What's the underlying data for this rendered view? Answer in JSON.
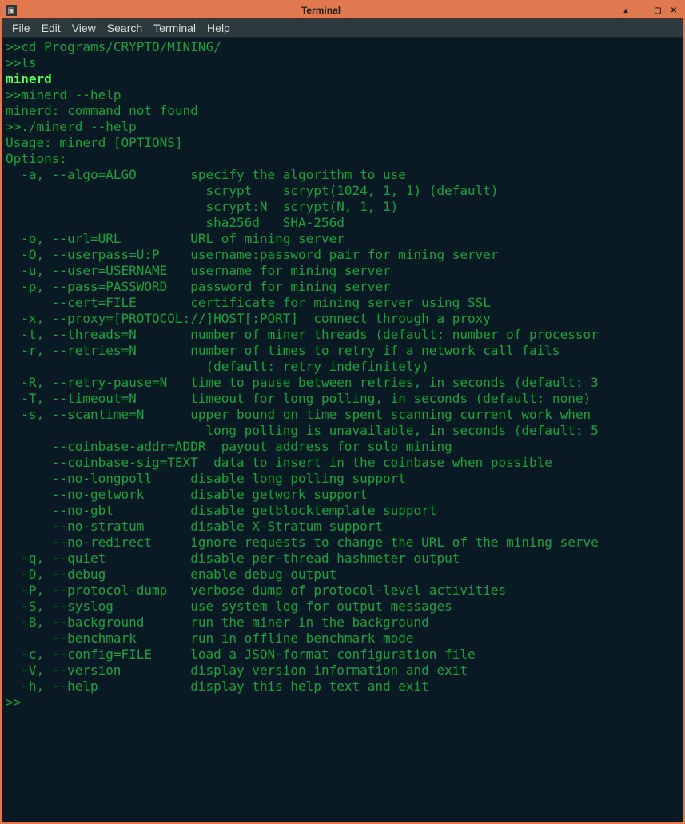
{
  "window": {
    "title": "Terminal",
    "sys_icon": "▣",
    "btn_collapse": "▴",
    "btn_minimize": "_",
    "btn_maximize": "▢",
    "btn_close": "✕"
  },
  "menubar": {
    "file": "File",
    "edit": "Edit",
    "view": "View",
    "search": "Search",
    "terminal": "Terminal",
    "help": "Help"
  },
  "terminal": {
    "lines": [
      {
        "t": "prompt",
        "text": ">>cd Programs/CRYPTO/MINING/"
      },
      {
        "t": "prompt",
        "text": ">>ls"
      },
      {
        "t": "exec",
        "text": "minerd"
      },
      {
        "t": "prompt",
        "text": ">>minerd --help"
      },
      {
        "t": "out",
        "text": "minerd: command not found"
      },
      {
        "t": "prompt",
        "text": ">>./minerd --help"
      },
      {
        "t": "out",
        "text": "Usage: minerd [OPTIONS]"
      },
      {
        "t": "out",
        "text": "Options:"
      },
      {
        "t": "out",
        "text": "  -a, --algo=ALGO       specify the algorithm to use"
      },
      {
        "t": "out",
        "text": "                          scrypt    scrypt(1024, 1, 1) (default)"
      },
      {
        "t": "out",
        "text": "                          scrypt:N  scrypt(N, 1, 1)"
      },
      {
        "t": "out",
        "text": "                          sha256d   SHA-256d"
      },
      {
        "t": "out",
        "text": "  -o, --url=URL         URL of mining server"
      },
      {
        "t": "out",
        "text": "  -O, --userpass=U:P    username:password pair for mining server"
      },
      {
        "t": "out",
        "text": "  -u, --user=USERNAME   username for mining server"
      },
      {
        "t": "out",
        "text": "  -p, --pass=PASSWORD   password for mining server"
      },
      {
        "t": "out",
        "text": "      --cert=FILE       certificate for mining server using SSL"
      },
      {
        "t": "out",
        "text": "  -x, --proxy=[PROTOCOL://]HOST[:PORT]  connect through a proxy"
      },
      {
        "t": "out",
        "text": "  -t, --threads=N       number of miner threads (default: number of processor"
      },
      {
        "t": "out",
        "text": "  -r, --retries=N       number of times to retry if a network call fails"
      },
      {
        "t": "out",
        "text": "                          (default: retry indefinitely)"
      },
      {
        "t": "out",
        "text": "  -R, --retry-pause=N   time to pause between retries, in seconds (default: 3"
      },
      {
        "t": "out",
        "text": "  -T, --timeout=N       timeout for long polling, in seconds (default: none)"
      },
      {
        "t": "out",
        "text": "  -s, --scantime=N      upper bound on time spent scanning current work when"
      },
      {
        "t": "out",
        "text": "                          long polling is unavailable, in seconds (default: 5"
      },
      {
        "t": "out",
        "text": "      --coinbase-addr=ADDR  payout address for solo mining"
      },
      {
        "t": "out",
        "text": "      --coinbase-sig=TEXT  data to insert in the coinbase when possible"
      },
      {
        "t": "out",
        "text": "      --no-longpoll     disable long polling support"
      },
      {
        "t": "out",
        "text": "      --no-getwork      disable getwork support"
      },
      {
        "t": "out",
        "text": "      --no-gbt          disable getblocktemplate support"
      },
      {
        "t": "out",
        "text": "      --no-stratum      disable X-Stratum support"
      },
      {
        "t": "out",
        "text": "      --no-redirect     ignore requests to change the URL of the mining serve"
      },
      {
        "t": "out",
        "text": "  -q, --quiet           disable per-thread hashmeter output"
      },
      {
        "t": "out",
        "text": "  -D, --debug           enable debug output"
      },
      {
        "t": "out",
        "text": "  -P, --protocol-dump   verbose dump of protocol-level activities"
      },
      {
        "t": "out",
        "text": "  -S, --syslog          use system log for output messages"
      },
      {
        "t": "out",
        "text": "  -B, --background      run the miner in the background"
      },
      {
        "t": "out",
        "text": "      --benchmark       run in offline benchmark mode"
      },
      {
        "t": "out",
        "text": "  -c, --config=FILE     load a JSON-format configuration file"
      },
      {
        "t": "out",
        "text": "  -V, --version         display version information and exit"
      },
      {
        "t": "out",
        "text": "  -h, --help            display this help text and exit"
      },
      {
        "t": "prompt",
        "text": ">>"
      }
    ]
  }
}
